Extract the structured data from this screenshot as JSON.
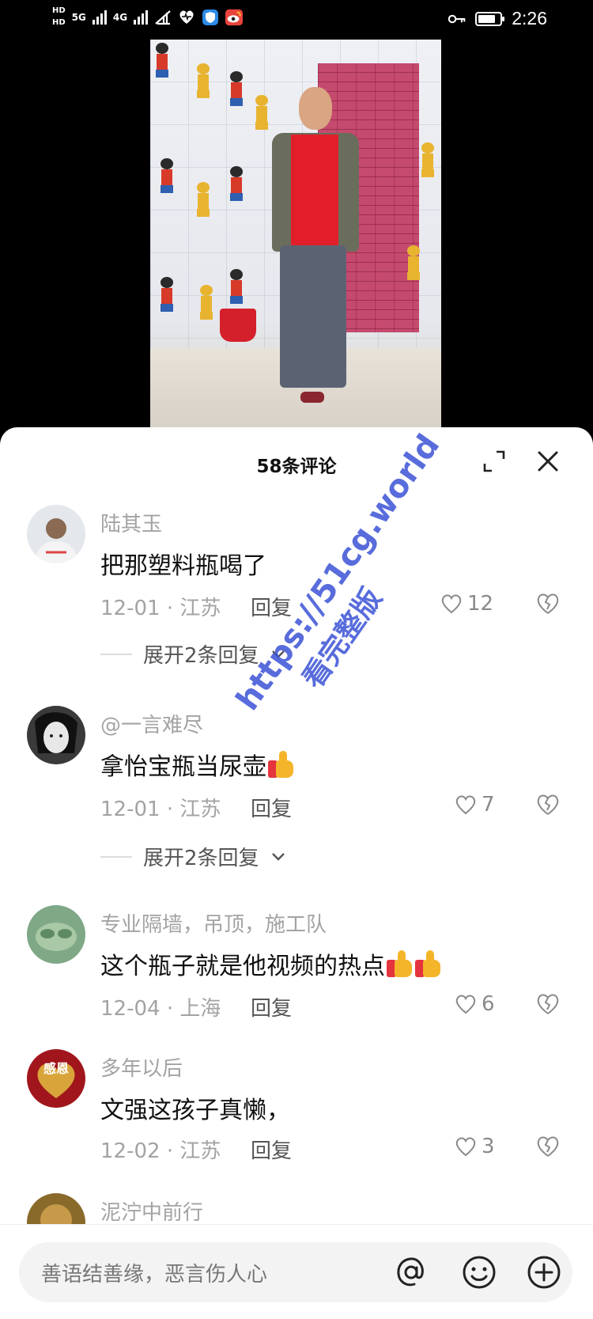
{
  "status_bar": {
    "hd1": "HD",
    "hd2": "HD",
    "net1": "5G",
    "net2": "4G",
    "time": "2:26",
    "battery_level": 0.8
  },
  "sheet": {
    "title": "58条评论"
  },
  "comments": [
    {
      "user": "陆其玉",
      "text": "把那塑料瓶喝了",
      "meta": "12-01 · 江苏",
      "reply": "回复",
      "likes": "12",
      "expand": "展开2条回复"
    },
    {
      "user": "@一言难尽",
      "text": "拿怡宝瓶当尿壶",
      "meta": "12-01 · 江苏",
      "reply": "回复",
      "likes": "7",
      "expand": "展开2条回复"
    },
    {
      "user": "专业隔墙，吊顶，施工队",
      "text": "这个瓶子就是他视频的热点",
      "meta": "12-04 · 上海",
      "reply": "回复",
      "likes": "6"
    },
    {
      "user": "多年以后",
      "text": "文强这孩子真懒，",
      "meta": "12-02 · 江苏",
      "reply": "回复",
      "likes": "3",
      "avatar_text": "感恩"
    },
    {
      "user": "泥泞中前行"
    }
  ],
  "input": {
    "placeholder": "善语结善缘，恶言伤人心"
  },
  "watermark": {
    "url": "https://51cg.world",
    "sub": "看完整版"
  },
  "colors": {
    "accent_watermark": "#3b53d6",
    "muted_text": "#a3a3a3",
    "shirt_red": "#e21e2a"
  }
}
